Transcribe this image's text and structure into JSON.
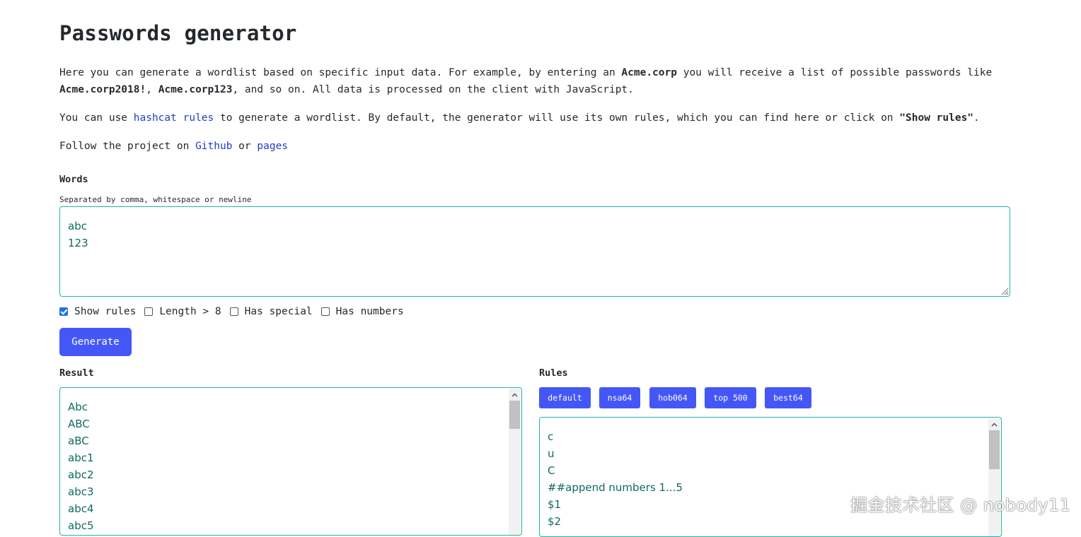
{
  "title": "Passwords generator",
  "intro": {
    "p1_a": "Here you can generate a wordlist based on specific input data. For example, by entering an ",
    "p1_b": "Acme.corp",
    "p1_c": " you will receive a list of possible passwords like",
    "p1_d": "Acme.corp2018!",
    "p1_e": ", ",
    "p1_f": "Acme.corp123",
    "p1_g": ", and so on. All data is processed on the client with JavaScript.",
    "p2_a": "You can use ",
    "p2_link": "hashcat rules",
    "p2_b": " to generate a wordlist. By default, the generator will use its own rules, which you can find here or click on ",
    "p2_c": "\"Show rules\"",
    "p2_d": ".",
    "p3_a": "Follow the project on ",
    "p3_link1": "Github",
    "p3_b": " or ",
    "p3_link2": "pages"
  },
  "words": {
    "label": "Words",
    "hint": "Separated by comma, whitespace or newline",
    "lines": [
      "abc",
      "123"
    ]
  },
  "options": [
    {
      "label": "Show rules",
      "checked": true
    },
    {
      "label": "Length > 8",
      "checked": false
    },
    {
      "label": "Has special",
      "checked": false
    },
    {
      "label": "Has numbers",
      "checked": false
    }
  ],
  "generate_label": "Generate",
  "result": {
    "label": "Result",
    "lines": [
      "Abc",
      "ABC",
      "aBC",
      "abc1",
      "abc2",
      "abc3",
      "abc4",
      "abc5"
    ]
  },
  "rules": {
    "label": "Rules",
    "presets": [
      "default",
      "nsa64",
      "hob064",
      "top 500",
      "best64"
    ],
    "lines": [
      "c",
      "u",
      "C",
      "##append numbers 1...5",
      "$1",
      "$2"
    ]
  },
  "watermark": "掘金技术社区 @ nobody11",
  "colors": {
    "accent": "#4457f6",
    "border": "#1fb5a5",
    "text_value": "#0f6b5e",
    "link": "#1f3fbf",
    "checkbox": "#1a73e8"
  },
  "icons": [
    "checkbox-checked-icon",
    "checkbox-icon",
    "scroll-up-icon",
    "resize-handle-icon"
  ]
}
